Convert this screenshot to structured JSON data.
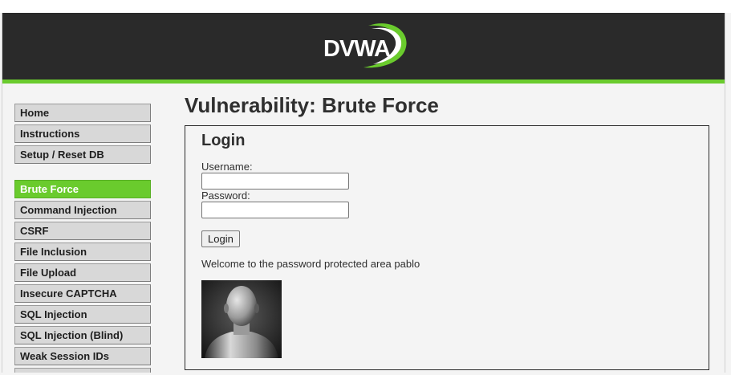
{
  "header": {
    "logo_text": "DVWA"
  },
  "menu": {
    "group1": [
      {
        "label": "Home"
      },
      {
        "label": "Instructions"
      },
      {
        "label": "Setup / Reset DB"
      }
    ],
    "group2": [
      {
        "label": "Brute Force",
        "active": true
      },
      {
        "label": "Command Injection"
      },
      {
        "label": "CSRF"
      },
      {
        "label": "File Inclusion"
      },
      {
        "label": "File Upload"
      },
      {
        "label": "Insecure CAPTCHA"
      },
      {
        "label": "SQL Injection"
      },
      {
        "label": "SQL Injection (Blind)"
      },
      {
        "label": "Weak Session IDs"
      }
    ]
  },
  "main": {
    "title": "Vulnerability: Brute Force",
    "form": {
      "title": "Login",
      "username_label": "Username:",
      "username_value": "",
      "password_label": "Password:",
      "password_value": "",
      "login_button": "Login"
    },
    "welcome_message": "Welcome to the password protected area pablo"
  },
  "colors": {
    "accent": "#6acb2d",
    "header_bg": "#2a2a2a",
    "page_bg": "#f4f4f4"
  }
}
